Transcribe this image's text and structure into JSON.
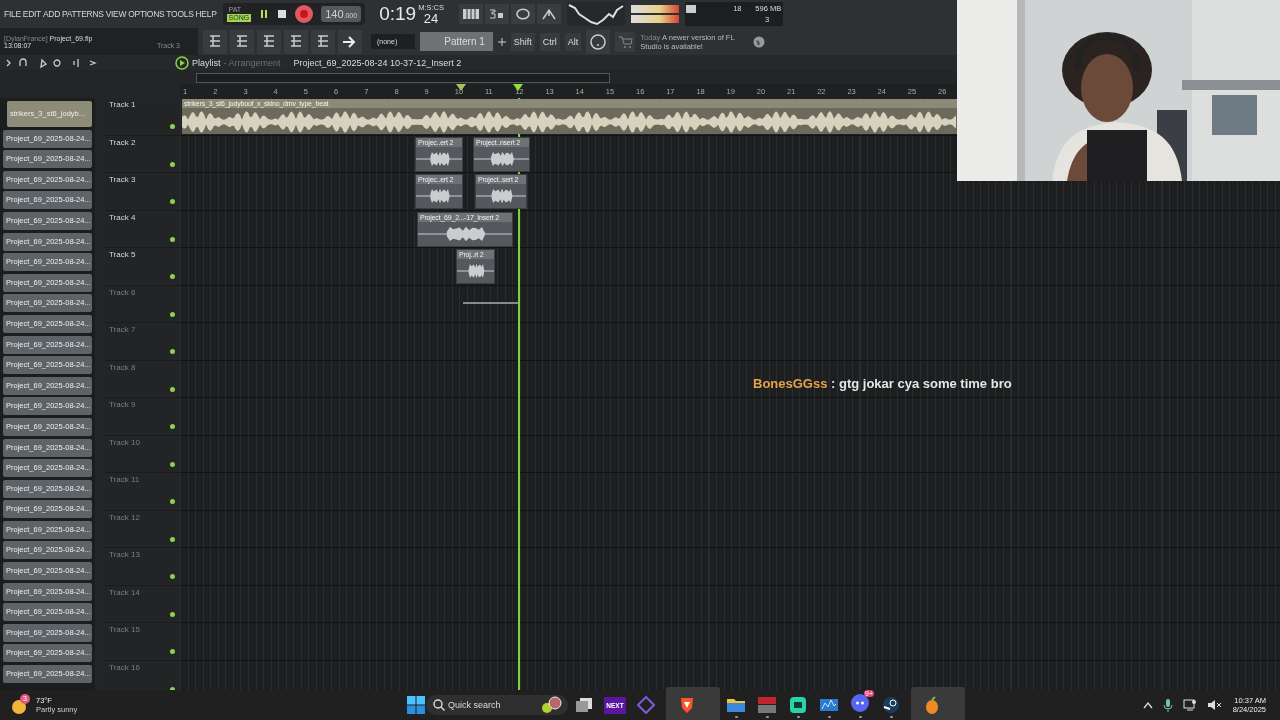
{
  "menu": [
    "FILE",
    "EDIT",
    "ADD",
    "PATTERNS",
    "VIEW",
    "OPTIONS",
    "TOOLS",
    "HELP"
  ],
  "transport": {
    "pat_label": "PAT",
    "song_label": "SONG",
    "song_mode": true,
    "tempo": "140",
    "tempo_decimals": ".000",
    "time": "0:19",
    "time_small": "24",
    "time_unit": "M:S:CS"
  },
  "cpu": {
    "voices": "18",
    "memory": "596 MB",
    "count": "3"
  },
  "info": {
    "user": "[DylanFrance]",
    "file": "Project_69.flp",
    "time": "13:08:07",
    "hint": "Track 3"
  },
  "pattern_select": "(none)",
  "pattern": "Pattern 1",
  "keys": [
    "Shift",
    "Ctrl",
    "Alt"
  ],
  "news": {
    "when": "Today",
    "text": "A newer version of FL Studio is available!"
  },
  "playlist": {
    "title": "Playlist",
    "subtitle": "- Arrangement",
    "current": "Project_69_2025-08-24 10-37-12_Insert 2"
  },
  "ruler": [
    "1",
    "2",
    "3",
    "4",
    "5",
    "6",
    "7",
    "8",
    "9",
    "10",
    "11",
    "12",
    "13",
    "14",
    "15",
    "16",
    "17",
    "18",
    "19",
    "20",
    "21",
    "22",
    "23",
    "24",
    "25",
    "26"
  ],
  "clip_list": [
    {
      "label": "strikers_3_st6_jodyb...",
      "selected": true
    },
    {
      "label": "Project_69_2025-08-24...",
      "selected": false
    },
    {
      "label": "Project_69_2025-08-24...",
      "selected": false
    },
    {
      "label": "Project_69_2025-08-24...",
      "selected": false
    },
    {
      "label": "Project_69_2025-08-24...",
      "selected": false
    },
    {
      "label": "Project_69_2025-08-24...",
      "selected": false
    },
    {
      "label": "Project_69_2025-08-24...",
      "selected": false
    },
    {
      "label": "Project_69_2025-08-24...",
      "selected": false
    },
    {
      "label": "Project_69_2025-08-24...",
      "selected": false
    },
    {
      "label": "Project_69_2025-08-24...",
      "selected": false
    },
    {
      "label": "Project_69_2025-08-24...",
      "selected": false
    },
    {
      "label": "Project_69_2025-08-24...",
      "selected": false
    },
    {
      "label": "Project_69_2025-08-24...",
      "selected": false
    },
    {
      "label": "Project_69_2025-08-24...",
      "selected": false
    },
    {
      "label": "Project_69_2025-08-24...",
      "selected": false
    },
    {
      "label": "Project_69_2025-08-24...",
      "selected": false
    },
    {
      "label": "Project_69_2025-08-24...",
      "selected": false
    },
    {
      "label": "Project_69_2025-08-24...",
      "selected": false
    },
    {
      "label": "Project_69_2025-08-24...",
      "selected": false
    },
    {
      "label": "Project_69_2025-08-24...",
      "selected": false
    },
    {
      "label": "Project_69_2025-08-24...",
      "selected": false
    },
    {
      "label": "Project_69_2025-08-24...",
      "selected": false
    },
    {
      "label": "Project_69_2025-08-24...",
      "selected": false
    },
    {
      "label": "Project_69_2025-08-24...",
      "selected": false
    },
    {
      "label": "Project_69_2025-08-24...",
      "selected": false
    },
    {
      "label": "Project_69_2025-08-24...",
      "selected": false
    },
    {
      "label": "Project_69_2025-08-24...",
      "selected": false
    },
    {
      "label": "Project_69_2025-08-24...",
      "selected": false
    }
  ],
  "tracks": [
    {
      "name": "Track 1",
      "dimmed": false,
      "clips": [
        {
          "kind": "beat",
          "label": "strikers_3_st6_jodyboof_x_skino_dmv_type_beat"
        }
      ]
    },
    {
      "name": "Track 2",
      "dimmed": false,
      "clips": [
        {
          "kind": "audio",
          "label": "Projec..ert 2"
        },
        {
          "kind": "audio",
          "label": "Project..nsert 2"
        }
      ]
    },
    {
      "name": "Track 3",
      "dimmed": false,
      "clips": [
        {
          "kind": "audio",
          "label": "Projec..ert 2"
        },
        {
          "kind": "audio",
          "label": "Project..sert 2"
        }
      ]
    },
    {
      "name": "Track 4",
      "dimmed": false,
      "clips": [
        {
          "kind": "audio",
          "label": "Project_69_2...-17_Insert 2"
        }
      ]
    },
    {
      "name": "Track 5",
      "dimmed": false,
      "clips": [
        {
          "kind": "audio",
          "label": "Proj..rt 2"
        }
      ]
    },
    {
      "name": "Track 6",
      "dimmed": true,
      "clips": [
        {
          "kind": "line"
        }
      ]
    },
    {
      "name": "Track 7",
      "dimmed": true
    },
    {
      "name": "Track 8",
      "dimmed": true
    },
    {
      "name": "Track 9",
      "dimmed": true
    },
    {
      "name": "Track 10",
      "dimmed": true
    },
    {
      "name": "Track 11",
      "dimmed": true
    },
    {
      "name": "Track 12",
      "dimmed": true
    },
    {
      "name": "Track 13",
      "dimmed": true
    },
    {
      "name": "Track 14",
      "dimmed": true
    },
    {
      "name": "Track 15",
      "dimmed": true
    },
    {
      "name": "Track 16",
      "dimmed": true
    }
  ],
  "chat": {
    "user": "BonesGGss",
    "message": ": gtg jokar cya some time bro",
    "color": "#e8a24a"
  },
  "taskbar": {
    "weather": {
      "temp": "73°F",
      "desc": "Partly sunny",
      "badge": "3"
    },
    "search": {
      "placeholder": "Quick search"
    },
    "apps": [
      {
        "kind": "files",
        "open": false,
        "selected": false
      },
      {
        "kind": "next",
        "label": "NEXT",
        "open": false,
        "selected": false
      },
      {
        "kind": "diamond",
        "open": false,
        "selected": false
      },
      {
        "kind": "lion",
        "open": true,
        "selected": true
      },
      {
        "kind": "folder",
        "open": true,
        "selected": false
      },
      {
        "kind": "meter",
        "open": true,
        "selected": false
      },
      {
        "kind": "chat",
        "open": true,
        "selected": false
      },
      {
        "kind": "audio",
        "open": true,
        "selected": false
      },
      {
        "kind": "discord",
        "badge": "9+",
        "open": true,
        "selected": false
      },
      {
        "kind": "steam",
        "open": true,
        "selected": false
      },
      {
        "kind": "fruit",
        "open": true,
        "selected": true
      }
    ],
    "time": "10:37 AM",
    "date": "8/24/2025"
  }
}
